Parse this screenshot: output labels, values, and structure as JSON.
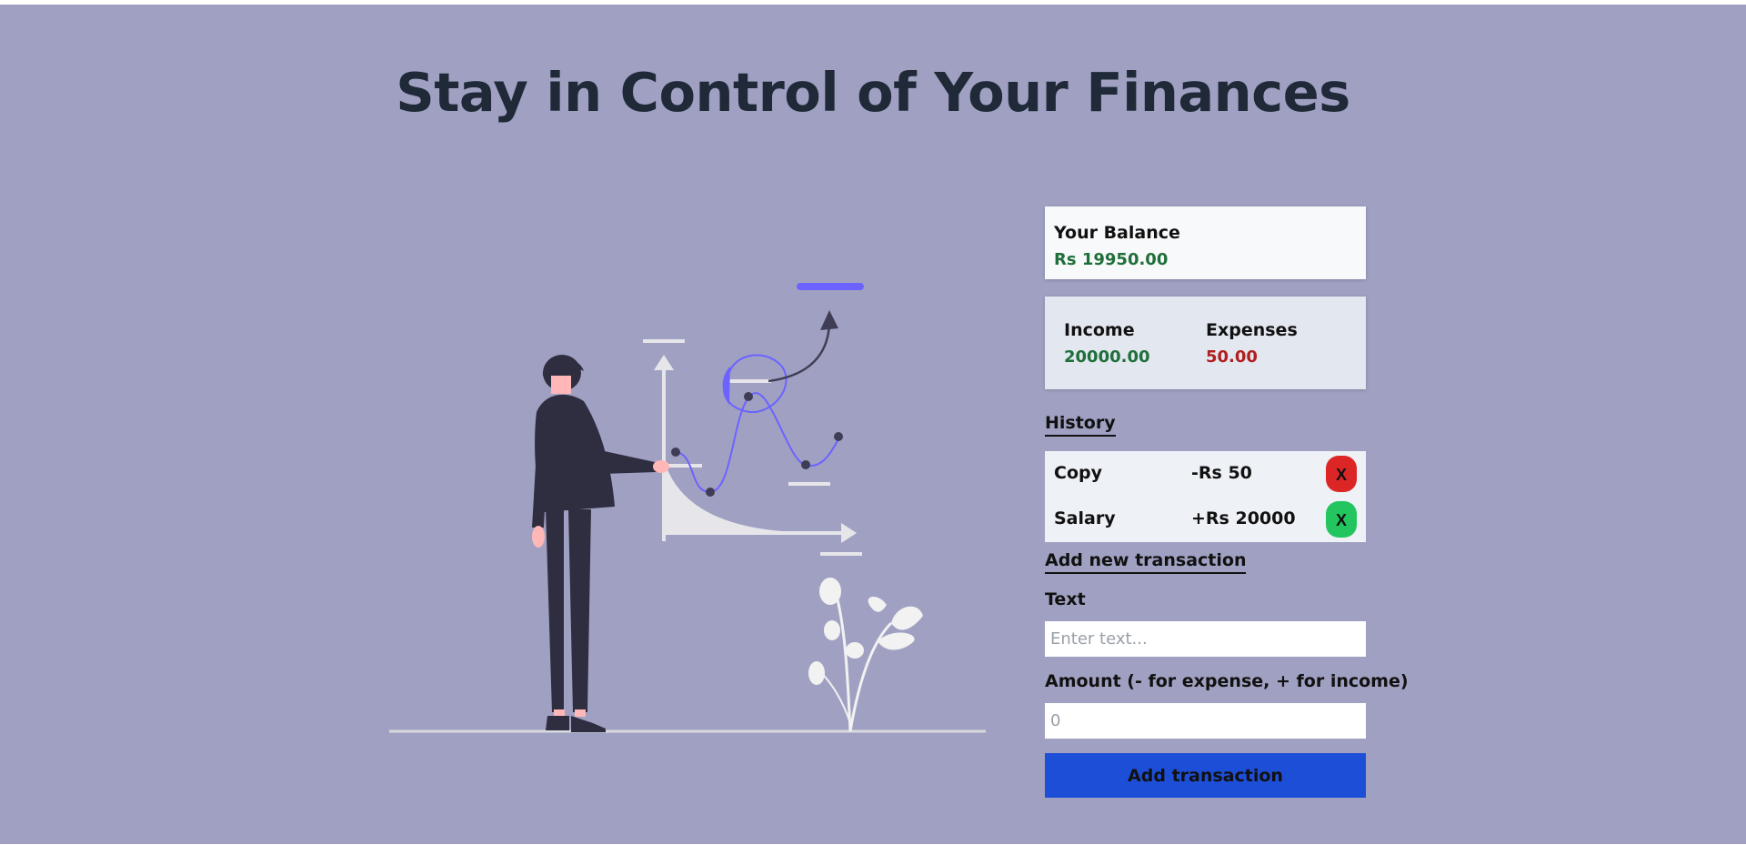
{
  "header": {
    "title": "Stay in Control of Your Finances"
  },
  "balance": {
    "label": "Your Balance",
    "value": "Rs 19950.00"
  },
  "summary": {
    "income_label": "Income",
    "income_value": "20000.00",
    "expenses_label": "Expenses",
    "expenses_value": "50.00"
  },
  "history": {
    "heading": "History",
    "items": [
      {
        "text": "Copy",
        "amount": "-Rs 50",
        "delete_label": "X",
        "type": "expense",
        "color": "#dc2626"
      },
      {
        "text": "Salary",
        "amount": "+Rs 20000",
        "delete_label": "X",
        "type": "income",
        "color": "#22c55e"
      }
    ]
  },
  "form": {
    "heading": "Add new transaction",
    "text_label": "Text",
    "text_placeholder": "Enter text...",
    "amount_label": "Amount (- for expense, + for income)",
    "amount_placeholder": "0",
    "submit_label": "Add transaction"
  },
  "colors": {
    "background": "#a0a1c2",
    "accent": "#1d4ed8",
    "income": "#1f6f3a",
    "expense": "#b11e1e",
    "illustration_accent": "#6c63ff"
  }
}
